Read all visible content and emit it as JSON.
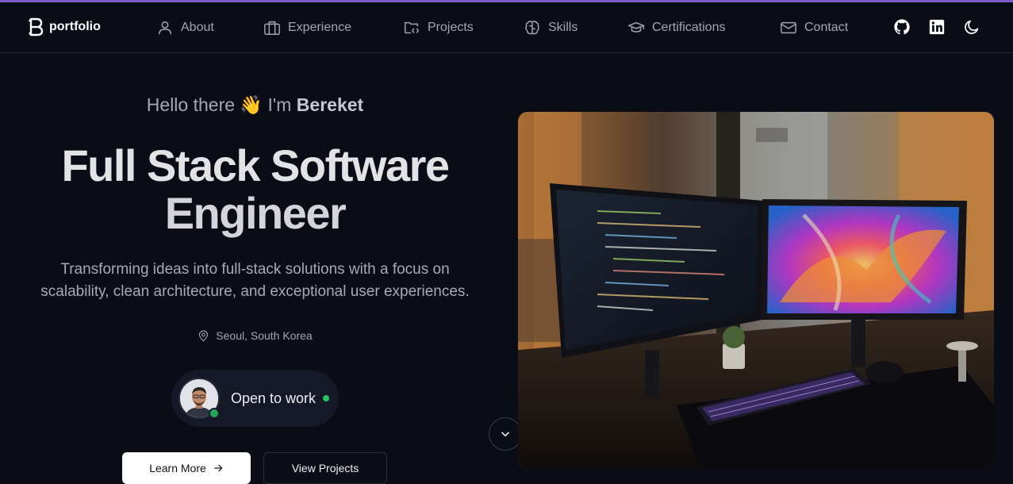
{
  "nav": {
    "brand_text": "portfolio",
    "items": [
      {
        "label": "About",
        "icon": "user-icon"
      },
      {
        "label": "Experience",
        "icon": "briefcase-icon"
      },
      {
        "label": "Projects",
        "icon": "folder-code-icon"
      },
      {
        "label": "Skills",
        "icon": "brain-icon"
      },
      {
        "label": "Certifications",
        "icon": "graduation-cap-icon"
      },
      {
        "label": "Contact",
        "icon": "mail-icon"
      }
    ],
    "actions": [
      "github-icon",
      "linkedin-icon",
      "moon-icon"
    ]
  },
  "hero": {
    "greeting_prefix": "Hello there",
    "greeting_emoji": "👋",
    "greeting_mid": "I'm",
    "name": "Bereket",
    "headline_line1": "Full Stack Software",
    "headline_line2": "Engineer",
    "tagline_line1": "Transforming ideas into full-stack solutions with a focus on",
    "tagline_line2": "scalability, clean architecture, and exceptional user experiences.",
    "location": "Seoul, South Korea",
    "status": "Open to work",
    "primary_button": "Learn More",
    "secondary_button": "View Projects"
  },
  "colors": {
    "background": "#0b0d16",
    "accent_bar": "#7c5cc4",
    "status_green": "#22c55e"
  }
}
